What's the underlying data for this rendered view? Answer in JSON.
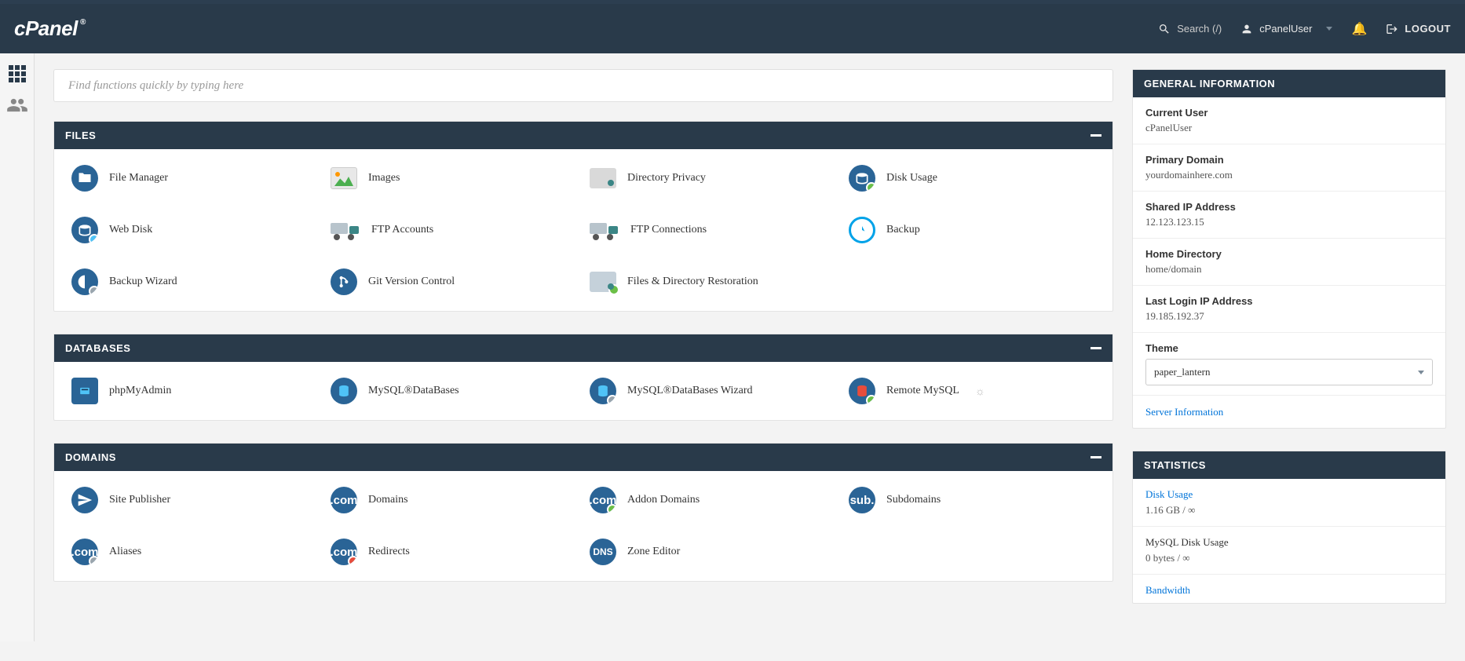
{
  "header": {
    "search_placeholder": "Search (/)",
    "username": "cPanelUser",
    "logout": "LOGOUT"
  },
  "quick_search": {
    "placeholder": "Find functions quickly by typing here"
  },
  "sections": {
    "files": {
      "title": "FILES",
      "items": [
        {
          "label": "File Manager"
        },
        {
          "label": "Images"
        },
        {
          "label": "Directory Privacy"
        },
        {
          "label": "Disk Usage"
        },
        {
          "label": "Web Disk"
        },
        {
          "label": "FTP Accounts"
        },
        {
          "label": "FTP Connections"
        },
        {
          "label": "Backup"
        },
        {
          "label": "Backup Wizard"
        },
        {
          "label": "Git Version Control"
        },
        {
          "label": "Files & Directory Restoration"
        }
      ]
    },
    "databases": {
      "title": "DATABASES",
      "items": [
        {
          "label": "phpMyAdmin"
        },
        {
          "label": "MySQL®DataBases"
        },
        {
          "label": "MySQL®DataBases Wizard"
        },
        {
          "label": "Remote MySQL"
        }
      ]
    },
    "domains": {
      "title": "DOMAINS",
      "items": [
        {
          "label": "Site Publisher"
        },
        {
          "label": "Domains"
        },
        {
          "label": "Addon Domains"
        },
        {
          "label": "Subdomains"
        },
        {
          "label": "Aliases"
        },
        {
          "label": "Redirects"
        },
        {
          "label": "Zone Editor"
        }
      ]
    }
  },
  "general_info": {
    "title": "GENERAL INFORMATION",
    "rows": [
      {
        "label": "Current User",
        "value": "cPanelUser"
      },
      {
        "label": "Primary Domain",
        "value": "yourdomainhere.com"
      },
      {
        "label": "Shared IP Address",
        "value": "12.123.123.15"
      },
      {
        "label": "Home Directory",
        "value": "home/domain"
      },
      {
        "label": "Last Login IP Address",
        "value": "19.185.192.37"
      }
    ],
    "theme_label": "Theme",
    "theme_value": "paper_lantern",
    "server_info": "Server Information"
  },
  "statistics": {
    "title": "STATISTICS",
    "rows": [
      {
        "title": "Disk Usage",
        "value": "1.16 GB / ∞",
        "link": true
      },
      {
        "title": "MySQL Disk Usage",
        "value": "0 bytes / ∞",
        "link": false
      }
    ],
    "bandwidth": "Bandwidth"
  }
}
